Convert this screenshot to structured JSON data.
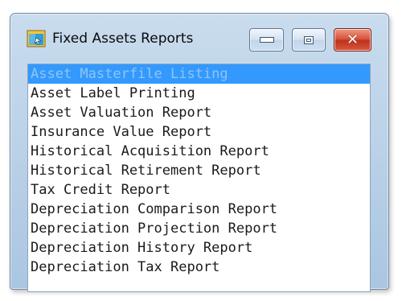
{
  "window": {
    "title": "Fixed Assets Reports",
    "icon": "report-app-icon",
    "controls": {
      "minimize": "minimize-icon",
      "maximize": "maximize-icon",
      "close": "close-icon"
    }
  },
  "reports": {
    "selected_index": 0,
    "items": [
      "Asset Masterfile Listing",
      "Asset Label Printing",
      "Asset Valuation Report",
      "Insurance Value Report",
      "Historical Acquisition Report",
      "Historical Retirement Report",
      "Tax Credit Report",
      "Depreciation Comparison Report",
      "Depreciation Projection Report",
      "Depreciation History Report",
      "Depreciation Tax Report"
    ]
  },
  "colors": {
    "selection": "#3399ff",
    "selection_text": "#8fc6f5",
    "frame": "#b7cfe6",
    "close_button": "#c0321c"
  }
}
